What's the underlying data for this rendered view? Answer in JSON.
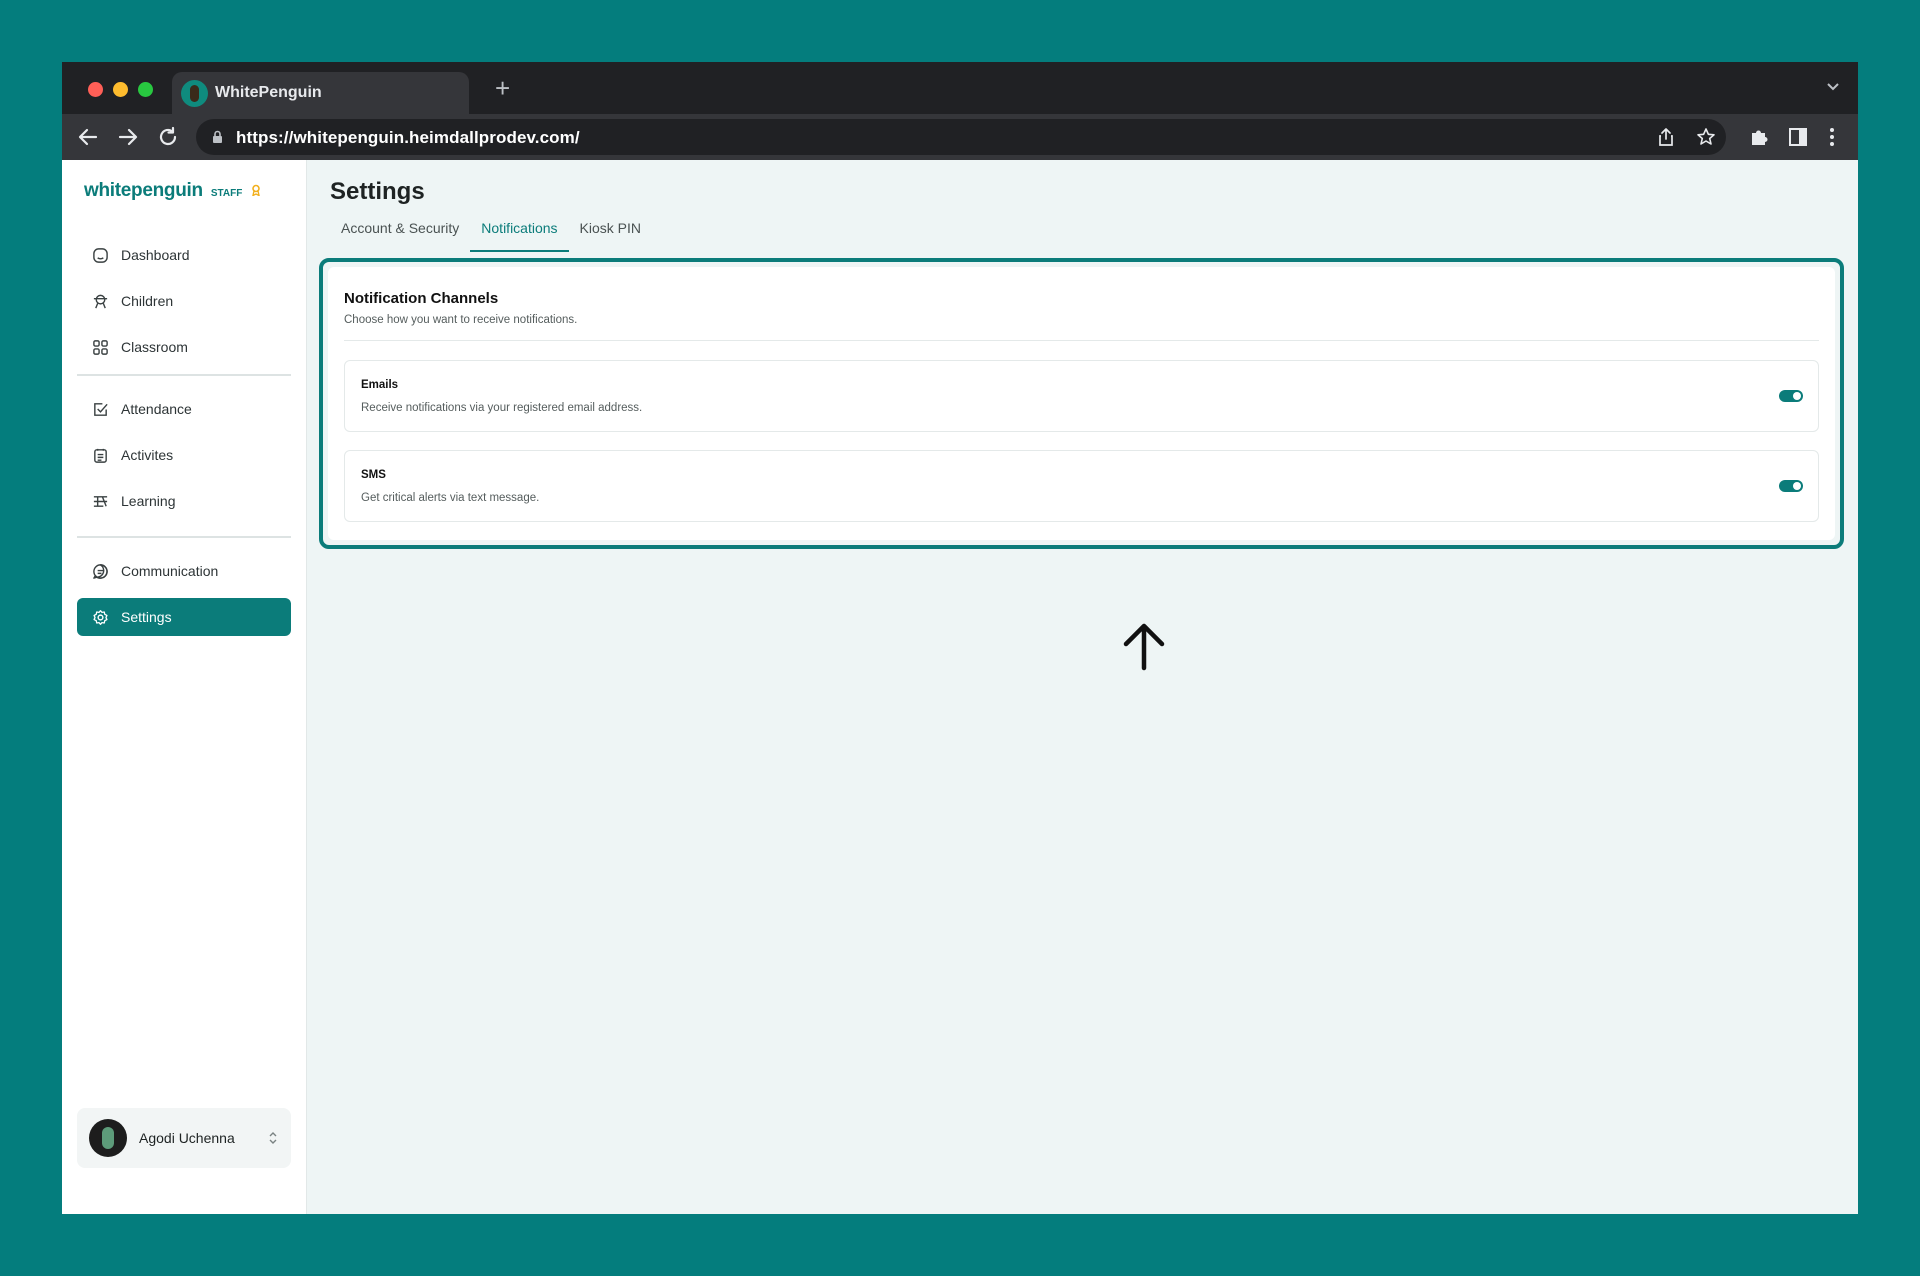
{
  "browser": {
    "tab_title": "WhitePenguin",
    "url": "https://whitepenguin.heimdallprodev.com/"
  },
  "brand": {
    "name": "whitepenguin",
    "tag": "STAFF"
  },
  "sidebar": {
    "group1": [
      {
        "label": "Dashboard",
        "icon": "dashboard-icon"
      },
      {
        "label": "Children",
        "icon": "children-icon"
      },
      {
        "label": "Classroom",
        "icon": "classroom-icon"
      }
    ],
    "group2": [
      {
        "label": "Attendance",
        "icon": "attendance-icon"
      },
      {
        "label": "Activites",
        "icon": "activities-icon"
      },
      {
        "label": "Learning",
        "icon": "learning-icon"
      }
    ],
    "group3": [
      {
        "label": "Communication",
        "icon": "communication-icon"
      },
      {
        "label": "Settings",
        "icon": "settings-icon",
        "active": true
      }
    ]
  },
  "user": {
    "name": "Agodi Uchenna"
  },
  "page": {
    "title": "Settings",
    "tabs": [
      {
        "label": "Account & Security",
        "active": false
      },
      {
        "label": "Notifications",
        "active": true
      },
      {
        "label": "Kiosk PIN",
        "active": false
      }
    ]
  },
  "notifications": {
    "title": "Notification Channels",
    "subtitle": "Choose how you want to receive notifications.",
    "channels": [
      {
        "title": "Emails",
        "description": "Receive notifications via your registered email address.",
        "enabled": true
      },
      {
        "title": "SMS",
        "description": "Get critical alerts via text message.",
        "enabled": true
      }
    ]
  },
  "colors": {
    "background": "#047d7d",
    "accent": "#0b7c7a",
    "badge": "#f2b01e"
  }
}
